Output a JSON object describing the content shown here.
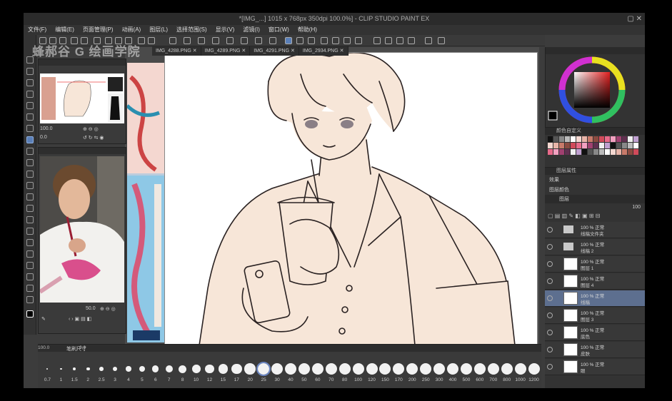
{
  "titlebar": {
    "title": "*[IMG_...] 1015 x 768px 350dpi 100.0%] - CLIP STUDIO PAINT EX"
  },
  "watermark": {
    "text": "蜂郝谷 G 绘画学院"
  },
  "menu": [
    "文件(F)",
    "编辑(E)",
    "页面管理(P)",
    "动画(A)",
    "图层(L)",
    "选择范围(S)",
    "显示(V)",
    "滤镜(I)",
    "窗口(W)",
    "帮助(H)"
  ],
  "tabs": [
    "IMG_4288.PNG",
    "IMG_4289.PNG",
    "IMG_4291.PNG",
    "IMG_2934.PNG"
  ],
  "navigator": {
    "zoom": "100.0",
    "angle": "0.0"
  },
  "subview": {
    "zoom": "50.0"
  },
  "colors": {
    "accent": "#5a7fb8",
    "panel": "#333333",
    "canvas": "#ffffff",
    "skin": "#f7e6d8"
  },
  "palette": {
    "title": "颜色自定义"
  },
  "layers": {
    "title": "图层属性",
    "properties_label": "效果",
    "blend_mode_label": "图层颜色",
    "opacity": "100",
    "tab": "图层",
    "items": [
      {
        "percent": "100 % 正常",
        "name": "线稿文件夹"
      },
      {
        "percent": "100 % 正常",
        "name": "线稿 2"
      },
      {
        "percent": "100 % 正常",
        "name": "图层 1"
      },
      {
        "percent": "100 % 正常",
        "name": "图层 4"
      },
      {
        "percent": "100 % 正常",
        "name": "线稿"
      },
      {
        "percent": "100 % 正常",
        "name": "图层 3"
      },
      {
        "percent": "100 % 正常",
        "name": "底色"
      },
      {
        "percent": "100 % 正常",
        "name": "皮肤"
      },
      {
        "percent": "100 % 正常",
        "name": "眼"
      }
    ]
  },
  "brushbar": {
    "tab": "笔刷尺寸",
    "sizes": [
      "0.7",
      "1",
      "1.5",
      "2",
      "2.5",
      "3",
      "4",
      "5",
      "6",
      "7",
      "8",
      "10",
      "12",
      "15",
      "17",
      "20",
      "25",
      "30",
      "40",
      "50",
      "60",
      "70",
      "80",
      "100",
      "120",
      "150",
      "170",
      "200",
      "250",
      "300",
      "400",
      "500",
      "600",
      "700",
      "800",
      "1000",
      "1200"
    ],
    "selected": "25"
  },
  "statusbar": {
    "zoom": "100.0",
    "angle": "0.0"
  }
}
